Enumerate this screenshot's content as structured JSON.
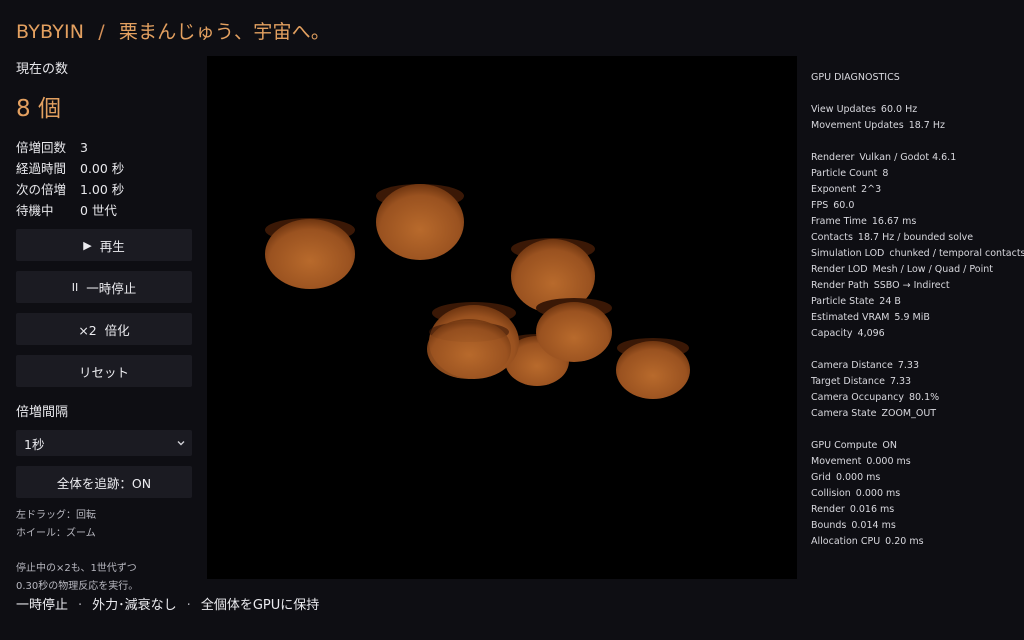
{
  "header": {
    "brand": "BYBYIN",
    "separator": "/",
    "title": "栗まんじゅう、宇宙へ。"
  },
  "counter": {
    "label": "現在の数",
    "value": "8 個"
  },
  "stats": [
    {
      "key": "倍増回数",
      "value": "3"
    },
    {
      "key": "経過時間",
      "value": "0.00 秒"
    },
    {
      "key": "次の倍増",
      "value": "1.00 秒"
    },
    {
      "key": "待機中",
      "value": "0 世代"
    }
  ],
  "buttons": {
    "play": {
      "icon": "play-icon",
      "label": "再生"
    },
    "pause": {
      "icon": "pause-icon",
      "label": "一時停止"
    },
    "double": {
      "icon": "times-two",
      "label": "×2  倍化"
    },
    "reset": {
      "label": "リセット"
    }
  },
  "interval": {
    "label": "倍増間隔",
    "selected": "1秒"
  },
  "follow_button": "全体を追跡：ON",
  "controls_hint": [
    "左ドラッグ：回転",
    "ホイール：ズーム"
  ],
  "note": [
    "停止中の×2も、1世代ずつ",
    "0.30秒の物理反応を実行。"
  ],
  "status_bar": [
    "一時停止",
    "外力･減衰なし",
    "全個体をGPUに保持"
  ],
  "diagnostics": {
    "heading": "GPU DIAGNOSTICS",
    "groups": [
      [
        {
          "k": "View Updates",
          "v": "60.0 Hz"
        },
        {
          "k": "Movement Updates",
          "v": "18.7 Hz"
        }
      ],
      [
        {
          "k": "Renderer",
          "v": "Vulkan / Godot 4.6.1"
        },
        {
          "k": "Particle Count",
          "v": "8"
        },
        {
          "k": "Exponent",
          "v": "2^3"
        },
        {
          "k": "FPS",
          "v": "60.0"
        },
        {
          "k": "Frame Time",
          "v": "16.67 ms"
        },
        {
          "k": "Contacts",
          "v": "18.7 Hz / bounded solve"
        },
        {
          "k": "Simulation LOD",
          "v": "chunked / temporal contacts"
        },
        {
          "k": "Render LOD",
          "v": "Mesh / Low / Quad / Point"
        },
        {
          "k": "Render Path",
          "v": "SSBO → Indirect"
        },
        {
          "k": "Particle State",
          "v": "24 B"
        },
        {
          "k": "Estimated VRAM",
          "v": "5.9 MiB"
        },
        {
          "k": "Capacity",
          "v": "4,096"
        }
      ],
      [
        {
          "k": "Camera Distance",
          "v": "7.33"
        },
        {
          "k": "Target Distance",
          "v": "7.33"
        },
        {
          "k": "Camera Occupancy",
          "v": "80.1%"
        },
        {
          "k": "Camera State",
          "v": "ZOOM_OUT"
        }
      ],
      [
        {
          "k": "GPU Compute",
          "v": "ON"
        },
        {
          "k": "Movement",
          "v": "0.000 ms"
        },
        {
          "k": "Grid",
          "v": "0.000 ms"
        },
        {
          "k": "Collision",
          "v": "0.000 ms"
        },
        {
          "k": "Render",
          "v": "0.016 ms"
        },
        {
          "k": "Bounds",
          "v": "0.014 ms"
        },
        {
          "k": "Allocation CPU",
          "v": "0.20 ms"
        }
      ]
    ]
  },
  "colors": {
    "accent": "#e3a060",
    "bun_light": "#b86a2c",
    "bun_dark": "#5a2a0c"
  }
}
